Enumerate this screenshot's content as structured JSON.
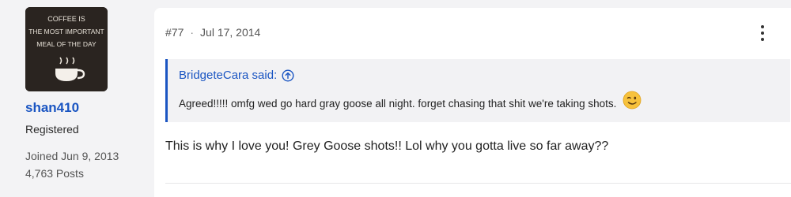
{
  "user": {
    "avatar_lines": [
      "COFFEE IS",
      "THE MOST IMPORTANT",
      "MEAL OF THE DAY"
    ],
    "username": "shan410",
    "role": "Registered",
    "joined": "Joined Jun 9, 2013",
    "posts": "4,763 Posts"
  },
  "post": {
    "number": "#77",
    "separator": "·",
    "date": "Jul 17, 2014",
    "more_icon": "vertical-ellipsis-icon",
    "quote": {
      "author": "BridgeteCara said:",
      "jump_icon": "arrow-up-circle-icon",
      "text": "Agreed!!!!! omfg wed go hard gray goose all night. forget chasing that shit we're taking shots.",
      "emoji": "winking-face-emoji"
    },
    "body": "This is why I love you! Grey Goose shots!! Lol why you gotta live so far away??"
  },
  "colors": {
    "link": "#1a55c2",
    "page_bg": "#f3f3f5",
    "card_bg": "#ffffff",
    "quote_bg": "#f2f2f4"
  }
}
